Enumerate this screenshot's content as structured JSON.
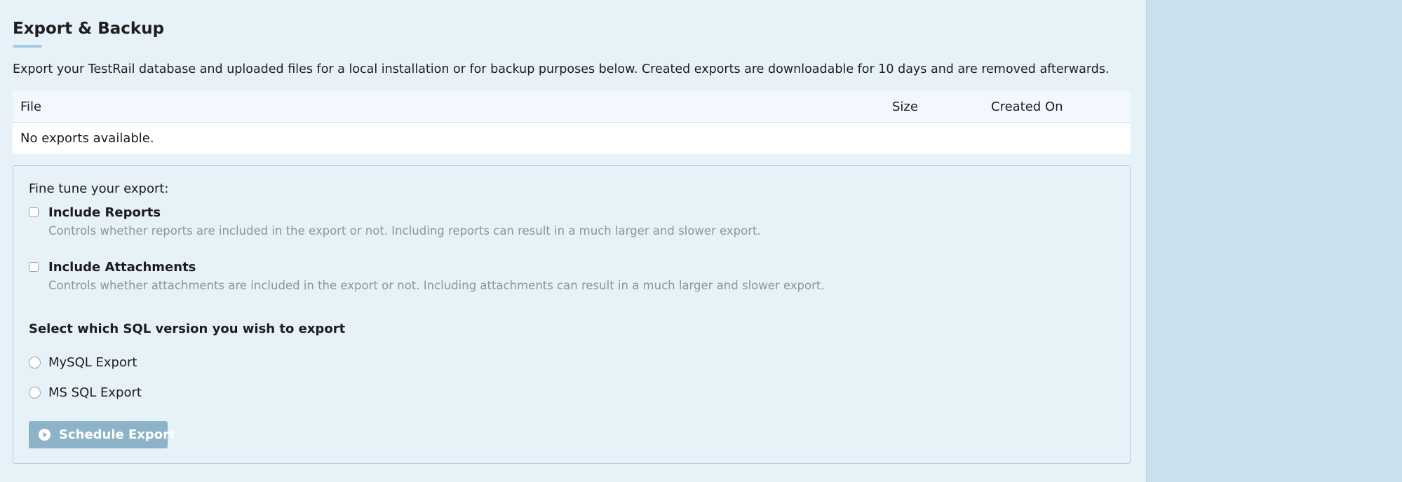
{
  "page": {
    "title": "Export & Backup",
    "intro": "Export your TestRail database and uploaded files for a local installation or for backup purposes below. Created exports are downloadable for 10 days and are removed afterwards."
  },
  "table": {
    "columns": {
      "file": "File",
      "size": "Size",
      "created_on": "Created On"
    },
    "empty_message": "No exports available."
  },
  "export_options": {
    "heading": "Fine tune your export:",
    "include_reports": {
      "label": "Include Reports",
      "description": "Controls whether reports are included in the export or not. Including reports can result in a much larger and slower export.",
      "checked": false
    },
    "include_attachments": {
      "label": "Include Attachments",
      "description": "Controls whether attachments are included in the export or not. Including attachments can result in a much larger and slower export.",
      "checked": false
    },
    "sql_heading": "Select which SQL version you wish to export",
    "sql_options": [
      {
        "label": "MySQL Export",
        "selected": false
      },
      {
        "label": "MS SQL Export",
        "selected": false
      }
    ],
    "schedule_button": {
      "label": "Schedule Export",
      "icon": "play-circle-icon",
      "disabled": true
    }
  },
  "colors": {
    "background": "#e7f1f8",
    "sidebar": "#c9e0ee",
    "button": "#8db3c9",
    "muted_text": "#8b959c"
  }
}
